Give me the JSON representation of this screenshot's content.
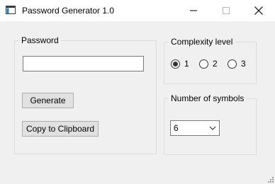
{
  "window": {
    "title": "Password Generator 1.0",
    "icon": "app-window-icon",
    "controls": {
      "minimize_icon": "minimize-icon",
      "maximize_icon": "maximize-icon",
      "close_icon": "close-icon"
    }
  },
  "password_group": {
    "label": "Password",
    "field_value": "",
    "generate_label": "Generate",
    "copy_label": "Copy to Clipboard"
  },
  "complexity_group": {
    "label": "Complexity level",
    "options": [
      {
        "label": "1",
        "selected": true
      },
      {
        "label": "2",
        "selected": false
      },
      {
        "label": "3",
        "selected": false
      }
    ]
  },
  "symbols_group": {
    "label": "Number of symbols",
    "selected": "6",
    "arrow_icon": "chevron-down-icon"
  },
  "colors": {
    "window_bg": "#f0f0f0",
    "titlebar_bg": "#ffffff",
    "button_bg": "#e1e1e1",
    "group_border": "#dcdcdc"
  }
}
